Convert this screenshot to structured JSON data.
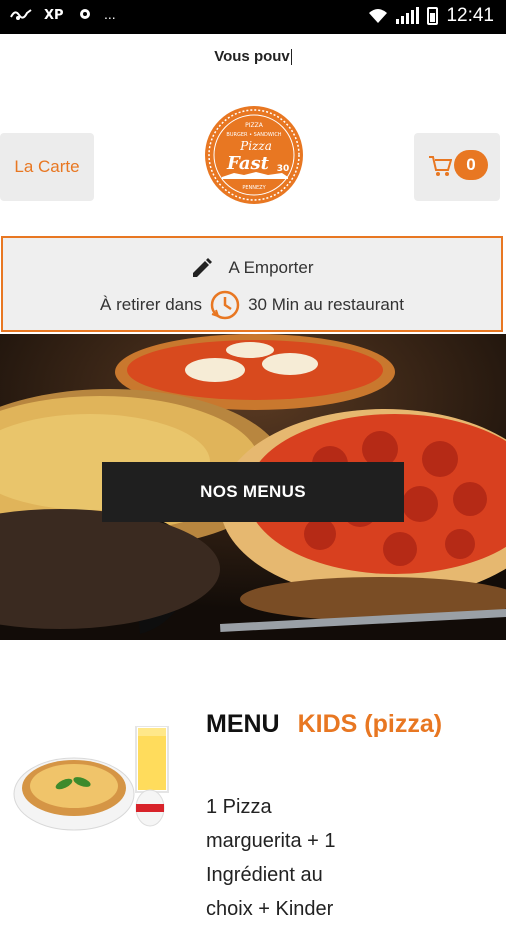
{
  "status_bar": {
    "time": "12:41",
    "dots": "...",
    "icons": [
      "mesh-icon",
      "xp-icon",
      "app-icon",
      "wifi-icon",
      "signal-icon",
      "battery-icon"
    ]
  },
  "header": {
    "marquee": "Vous pouv",
    "carte_label": "La Carte",
    "cart_count": "0",
    "logo_text": {
      "top": "PIZZA",
      "middle": "BURGER • SANDWICH",
      "name": "Pizza",
      "fast": "Fast",
      "num": "30",
      "city": "PENNEZY"
    }
  },
  "order": {
    "mode": "A Emporter",
    "pickup_prefix": "À retirer dans",
    "pickup_suffix": "30 Min au restaurant"
  },
  "hero": {
    "button_label": "NOS MENUS"
  },
  "menu_item": {
    "title": "MENU",
    "title_highlight": "KIDS (pizza)",
    "description_lines": [
      "1 Pizza",
      "marguerita + 1",
      "Ingrédient au",
      "choix + Kinder"
    ]
  },
  "colors": {
    "accent": "#e87722",
    "button_dark": "#1f1f1f",
    "panel": "#efefef"
  }
}
